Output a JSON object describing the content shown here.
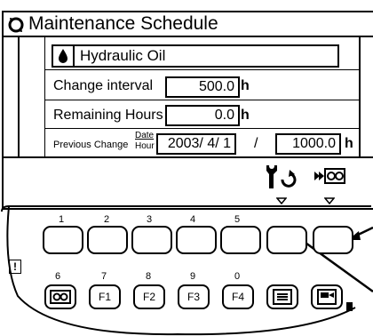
{
  "screen": {
    "title": "Maintenance Schedule",
    "item_name": "Hydraulic Oil",
    "change_interval": {
      "label": "Change interval",
      "value": "500.0",
      "unit": "h"
    },
    "remaining_hours": {
      "label": "Remaining Hours",
      "value": "0.0",
      "unit": "h"
    },
    "previous_change": {
      "label": "Previous Change",
      "sub_top": "Date",
      "sub_bottom": "Hour",
      "date": "2003/ 4/ 1",
      "separator": "/",
      "hour": "1000.0",
      "unit": "h"
    },
    "softkey_icons": [
      "wrench-reset-icon",
      "go-to-next-screen-icon"
    ]
  },
  "keypad": {
    "top_row_numbers": [
      "1",
      "2",
      "3",
      "4",
      "5"
    ],
    "bottom_row_numbers": [
      "6",
      "7",
      "8",
      "9",
      "0"
    ],
    "function_keys": [
      "F1",
      "F2",
      "F3",
      "F4"
    ],
    "warning_symbol": "!"
  }
}
